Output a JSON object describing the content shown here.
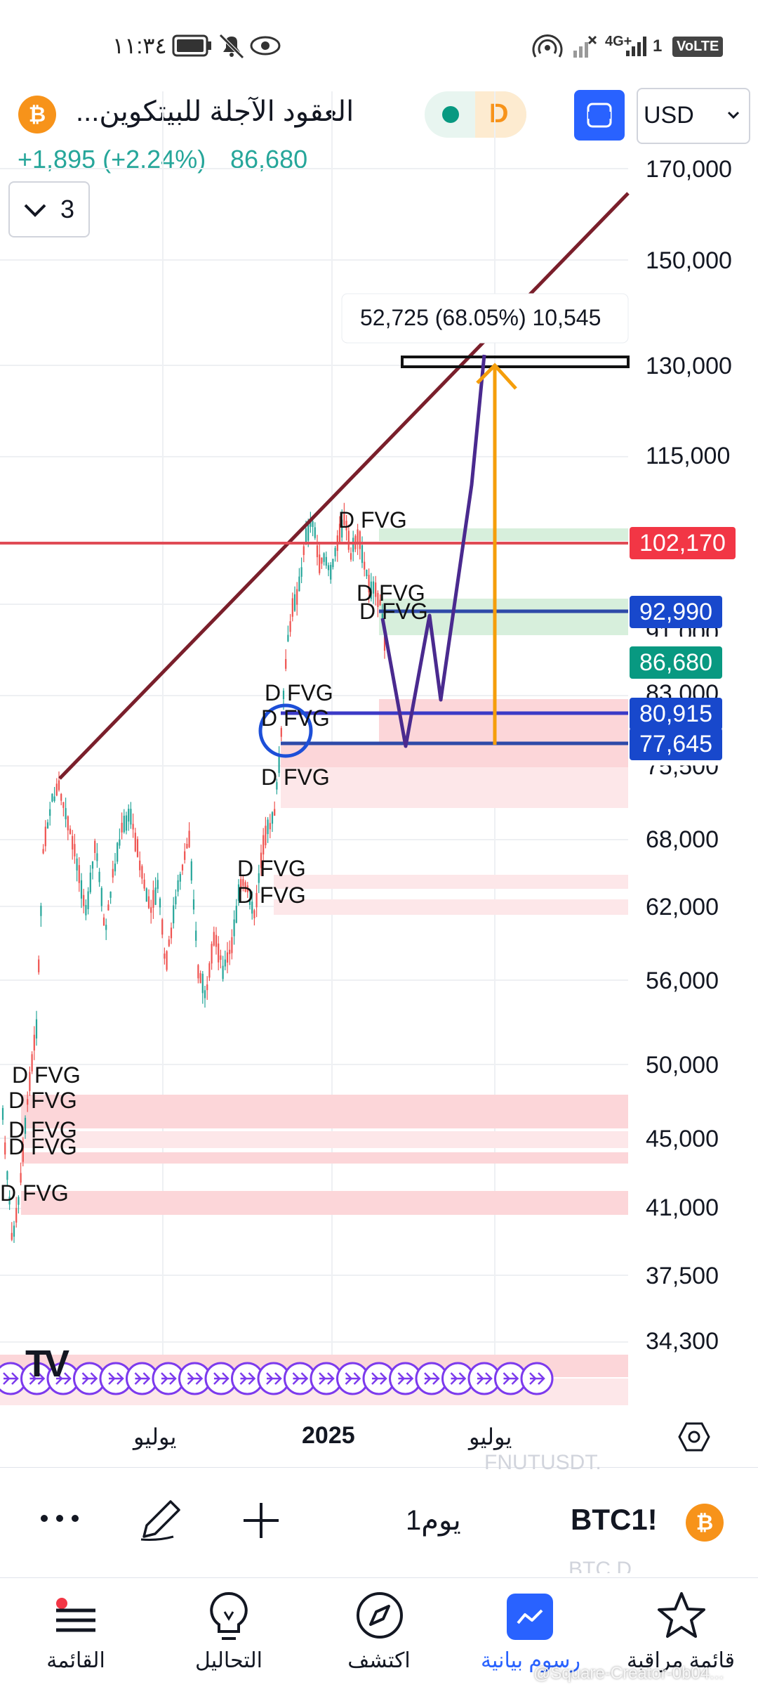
{
  "status_bar": {
    "time": "١١:٣٤",
    "network": "4G+",
    "volte": "VoLTE",
    "battery_icon": "battery-icon",
    "sim_number": "1"
  },
  "header": {
    "symbol_name": "العقود الآجلة للبيتكوين...",
    "interval_badge": "D",
    "currency": "USD",
    "change": "+1,895 (+2.24%)",
    "last_price": "86,680",
    "indicator_count": "3",
    "icons": [
      "bitcoin-icon",
      "status-dot-icon",
      "fullscreen-icon",
      "chevron-down-icon"
    ]
  },
  "chart_data": {
    "type": "candlestick",
    "symbol": "BTC1!",
    "y_ticks": [
      "170,000",
      "150,000",
      "130,000",
      "115,000",
      "83,000",
      "68,000",
      "62,000",
      "56,000",
      "50,000",
      "45,000",
      "41,000",
      "37,500",
      "34,300"
    ],
    "x_ticks": [
      "يوليو",
      "2025",
      "يوليو"
    ],
    "price_tags": [
      {
        "label": "102,170",
        "color": "#f23645"
      },
      {
        "label": "92,990",
        "color": "#1848cc"
      },
      {
        "label": "86,680",
        "color": "#089981"
      },
      {
        "label": "80,915",
        "color": "#1848cc"
      },
      {
        "label": "77,645",
        "color": "#1848cc"
      }
    ],
    "partially_hidden_ticks": [
      "91,000",
      "75,500"
    ],
    "measure_label": "52,725 (68.05%) 10,545",
    "fvg_label": "D FVG",
    "watermark": "TV"
  },
  "bottom_toolbar": {
    "symbol": "BTC1!",
    "interval": "1يوم",
    "ghost_top": "FNUTUSDT.",
    "ghost_bottom": "BTC.D"
  },
  "nav": {
    "items": [
      {
        "label": "القائمة",
        "icon": "menu-icon"
      },
      {
        "label": "التحاليل",
        "icon": "lightbulb-icon"
      },
      {
        "label": "اكتشف",
        "icon": "compass-icon"
      },
      {
        "label": "رسوم بيانية",
        "icon": "chart-icon"
      },
      {
        "label": "قائمة مراقبة",
        "icon": "star-icon"
      }
    ],
    "watermark": "@Square-Creator-0b04..."
  }
}
